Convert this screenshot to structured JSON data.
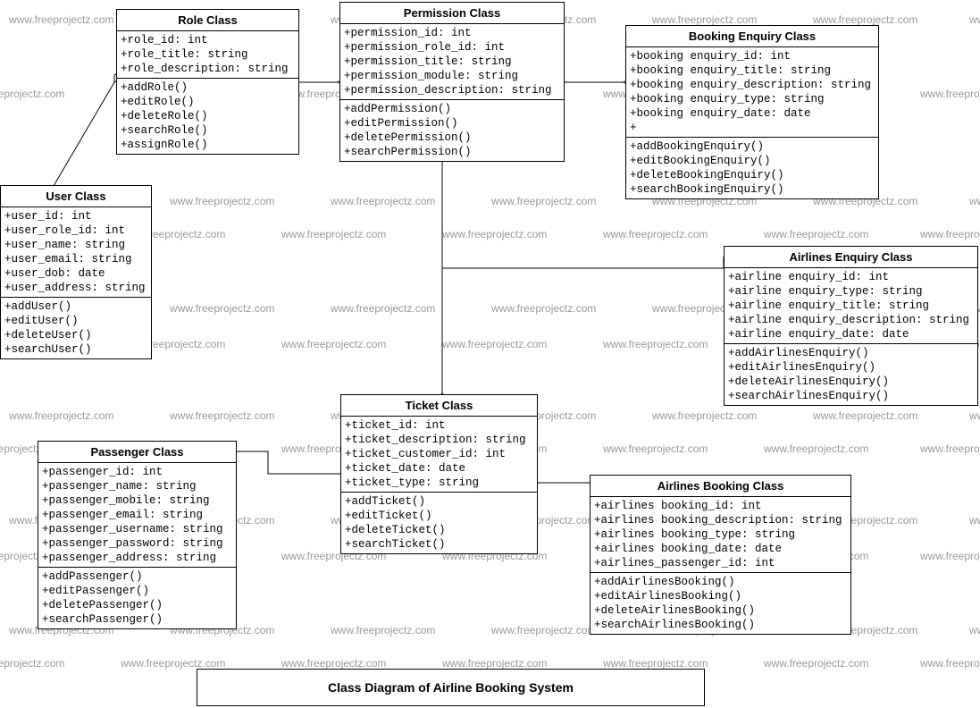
{
  "watermark_text": "www.freeprojectz.com",
  "caption": "Class Diagram of Airline Booking System",
  "classes": {
    "role": {
      "title": "Role Class",
      "attrs": [
        "+role_id: int",
        "+role_title: string",
        "+role_description: string"
      ],
      "ops": [
        "+addRole()",
        "+editRole()",
        "+deleteRole()",
        "+searchRole()",
        "+assignRole()"
      ]
    },
    "permission": {
      "title": "Permission Class",
      "attrs": [
        "+permission_id: int",
        "+permission_role_id: int",
        "+permission_title: string",
        "+permission_module: string",
        "+permission_description: string"
      ],
      "ops": [
        "+addPermission()",
        "+editPermission()",
        "+deletePermission()",
        "+searchPermission()"
      ]
    },
    "booking_enquiry": {
      "title": "Booking Enquiry Class",
      "attrs": [
        "+booking enquiry_id: int",
        "+booking enquiry_title: string",
        "+booking enquiry_description: string",
        "+booking enquiry_type: string",
        "+booking enquiry_date: date",
        "+"
      ],
      "ops": [
        "+addBookingEnquiry()",
        "+editBookingEnquiry()",
        "+deleteBookingEnquiry()",
        "+searchBookingEnquiry()"
      ]
    },
    "user": {
      "title": "User Class",
      "attrs": [
        "+user_id: int",
        "+user_role_id: int",
        "+user_name: string",
        "+user_email: string",
        "+user_dob: date",
        "+user_address: string"
      ],
      "ops": [
        "+addUser()",
        "+editUser()",
        "+deleteUser()",
        "+searchUser()"
      ]
    },
    "airlines_enquiry": {
      "title": "Airlines Enquiry Class",
      "attrs": [
        "+airline enquiry_id: int",
        "+airline enquiry_type: string",
        "+airline enquiry_title: string",
        "+airline enquiry_description: string",
        "+airline enquiry_date: date"
      ],
      "ops": [
        "+addAirlinesEnquiry()",
        "+editAirlinesEnquiry()",
        "+deleteAirlinesEnquiry()",
        "+searchAirlinesEnquiry()"
      ]
    },
    "ticket": {
      "title": "Ticket Class",
      "attrs": [
        "+ticket_id: int",
        "+ticket_description: string",
        "+ticket_customer_id: int",
        "+ticket_date: date",
        "+ticket_type: string"
      ],
      "ops": [
        "+addTicket()",
        "+editTicket()",
        "+deleteTicket()",
        "+searchTicket()"
      ]
    },
    "passenger": {
      "title": "Passenger Class",
      "attrs": [
        "+passenger_id: int",
        "+passenger_name: string",
        "+passenger_mobile: string",
        "+passenger_email: string",
        "+passenger_username: string",
        "+passenger_password: string",
        "+passenger_address: string"
      ],
      "ops": [
        "+addPassenger()",
        "+editPassenger()",
        "+deletePassenger()",
        "+searchPassenger()"
      ]
    },
    "airlines_booking": {
      "title": "Airlines Booking Class",
      "attrs": [
        "+airlines booking_id: int",
        "+airlines booking_description: string",
        "+airlines booking_type: string",
        "+airlines booking_date: date",
        "+airlines_passenger_id: int"
      ],
      "ops": [
        "+addAirlinesBooking()",
        "+editAirlinesBooking()",
        "+deleteAirlinesBooking()",
        "+searchAirlinesBooking()"
      ]
    }
  }
}
